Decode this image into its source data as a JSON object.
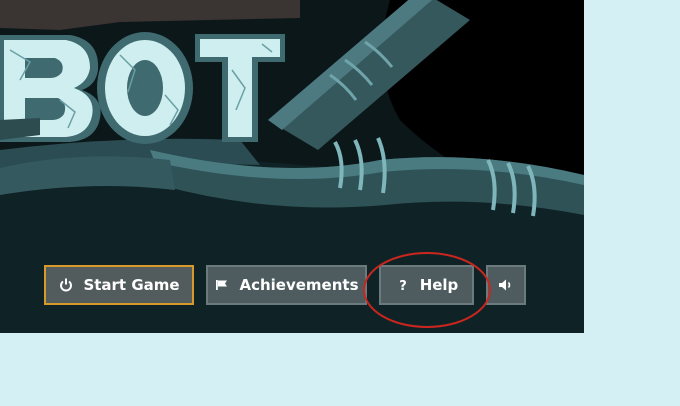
{
  "logo": {
    "text": "BOT"
  },
  "menu": {
    "start_label": "Start Game",
    "start_icon": "power-icon",
    "achievements_label": "Achievements",
    "achievements_icon": "flag-icon",
    "help_label": "Help",
    "help_icon": "question-icon",
    "sound_icon": "speaker-icon"
  },
  "colors": {
    "page_background": "#d4f0f4",
    "game_background": "#0d1a1c",
    "button_background": "#4f5c5f",
    "start_border": "#d79a2a",
    "annotation_circle": "#c8261e"
  }
}
